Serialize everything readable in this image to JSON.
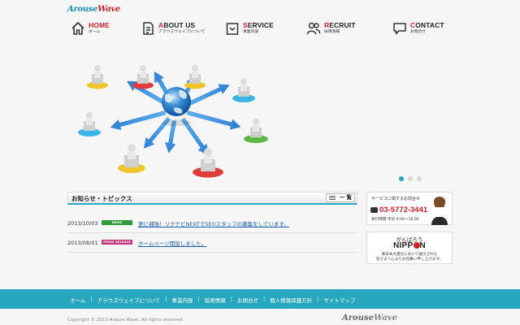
{
  "brand": {
    "logo_main": "Arouse",
    "logo_accent": "Wave"
  },
  "nav": [
    {
      "en_first": "H",
      "en_rest": "OME",
      "jp": "ホーム",
      "icon": "home-icon",
      "active": true
    },
    {
      "en_first": "A",
      "en_rest": "BOUT US",
      "jp": "アラウズウェイブについて",
      "icon": "document-icon",
      "active": false
    },
    {
      "en_first": "S",
      "en_rest": "ERVICE",
      "jp": "事業内容",
      "icon": "service-icon",
      "active": false
    },
    {
      "en_first": "R",
      "en_rest": "ECRUIT",
      "jp": "採用情報",
      "icon": "people-icon",
      "active": false
    },
    {
      "en_first": "C",
      "en_rest": "ONTACT",
      "jp": "お問合せ",
      "icon": "chat-icon",
      "active": false
    }
  ],
  "slider": {
    "total": 3,
    "active": 0
  },
  "news": {
    "title": "お知らせ・トピックス",
    "list_label": "一 覧",
    "items": [
      {
        "date": "2013/10/03",
        "badge": "NEWS",
        "badge_color": "#2e9c3a",
        "text": "更に補強！リクナビNEXTでSEOスタッフの募集をしています。"
      },
      {
        "date": "2013/08/01",
        "badge": "PRESS RELEASE",
        "badge_color": "#c3327a",
        "text": "ホームページ開設しました。"
      }
    ]
  },
  "contact": {
    "label": "サービスに関するお問合せ",
    "phone": "03-5772-3441",
    "hours": "受付時間:平日 9:00～18:00"
  },
  "banner": {
    "line1": "がんばろう",
    "line2_a": "NIPP",
    "line2_b": "N",
    "line3a": "東日本大震災において被災された",
    "line3b": "皆さまへ心よりお見舞い申し上げます。"
  },
  "footer": {
    "links": [
      "ホーム",
      "アラウズウェイブについて",
      "事業内容",
      "採用情報",
      "お問合せ",
      "個人情報保護方針",
      "サイトマップ"
    ],
    "copyright": "Copyright © 2013 Arouse Wave. All rights reserved.",
    "logo_main": "Arouse",
    "logo_accent": "Wave"
  },
  "colors": {
    "accent": "#27a7bd",
    "brand_red": "#d0202c",
    "link": "#1a5fa8"
  }
}
